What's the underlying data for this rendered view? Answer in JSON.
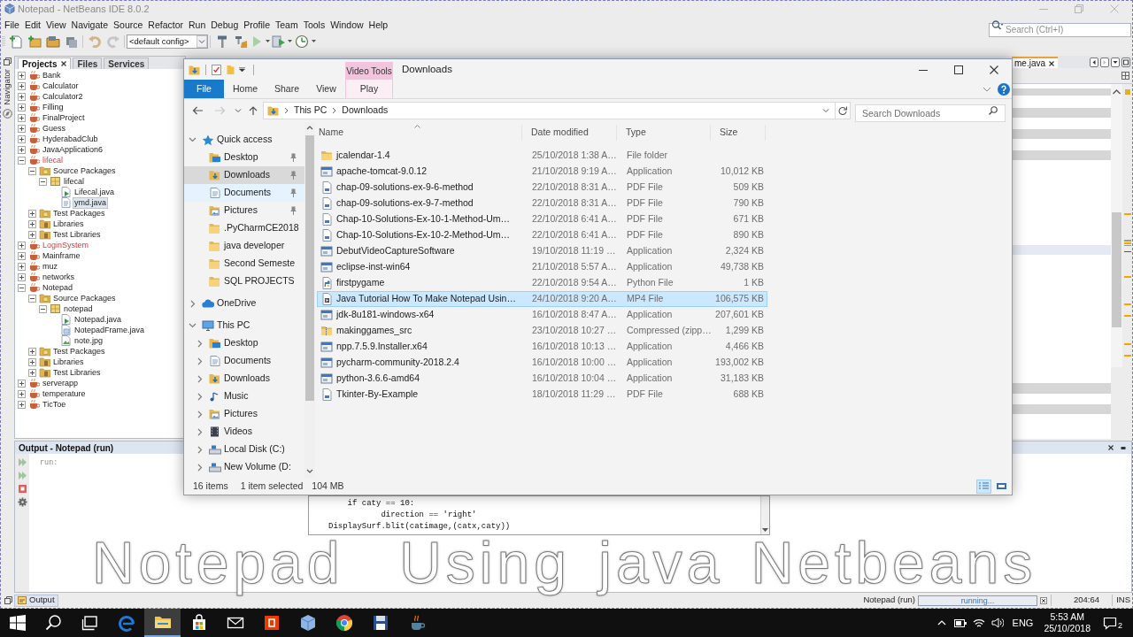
{
  "ide": {
    "title": "Notepad - NetBeans IDE 8.0.2",
    "menu": [
      "File",
      "Edit",
      "View",
      "Navigate",
      "Source",
      "Refactor",
      "Run",
      "Debug",
      "Profile",
      "Team",
      "Tools",
      "Window",
      "Help"
    ],
    "config": "<default config>",
    "search": {
      "placeholder": "Search (Ctrl+I)"
    },
    "side_label": "Navigator",
    "panel_tabs": [
      {
        "label": "Projects",
        "selected": true
      },
      {
        "label": "Files",
        "selected": false
      },
      {
        "label": "Services",
        "selected": false
      }
    ],
    "projects": [
      {
        "label": "Bank",
        "kind": "project",
        "expanded": false,
        "has_errors": false,
        "selected": false
      },
      {
        "label": "Calculator",
        "kind": "project",
        "expanded": false,
        "has_errors": false,
        "selected": false
      },
      {
        "label": "Calculator2",
        "kind": "project",
        "expanded": false,
        "has_errors": false,
        "selected": false
      },
      {
        "label": "Filling",
        "kind": "project",
        "expanded": false,
        "has_errors": false,
        "selected": false
      },
      {
        "label": "FinalProject",
        "kind": "project",
        "expanded": false,
        "has_errors": false,
        "selected": false
      },
      {
        "label": "Guess",
        "kind": "project",
        "expanded": false,
        "has_errors": false,
        "selected": false
      },
      {
        "label": "HyderabadClub",
        "kind": "project",
        "expanded": false,
        "has_errors": false,
        "selected": false
      },
      {
        "label": "JavaApplication6",
        "kind": "project",
        "expanded": false,
        "has_errors": false,
        "selected": false
      },
      {
        "label": "lifecal",
        "kind": "project",
        "expanded": true,
        "has_errors": true,
        "selected": false,
        "children": [
          {
            "label": "Source Packages",
            "kind": "source_folder",
            "expanded": true,
            "selected": false,
            "children": [
              {
                "label": "lifecal",
                "kind": "package",
                "expanded": true,
                "selected": false,
                "children": [
                  {
                    "label": "Lifecal.java",
                    "kind": "java_main",
                    "selected": false
                  },
                  {
                    "label": "ymd.java",
                    "kind": "java",
                    "selected": true
                  }
                ]
              }
            ]
          },
          {
            "label": "Test Packages",
            "kind": "source_folder",
            "expanded": false,
            "selected": false
          },
          {
            "label": "Libraries",
            "kind": "library",
            "expanded": false,
            "selected": false
          },
          {
            "label": "Test Libraries",
            "kind": "library",
            "expanded": false,
            "selected": false
          }
        ]
      },
      {
        "label": "LoginSystem",
        "kind": "project",
        "expanded": false,
        "has_errors": true,
        "selected": false
      },
      {
        "label": "Mainframe",
        "kind": "project",
        "expanded": false,
        "has_errors": false,
        "selected": false
      },
      {
        "label": "muz",
        "kind": "project",
        "expanded": false,
        "has_errors": false,
        "selected": false
      },
      {
        "label": "networks",
        "kind": "project",
        "expanded": false,
        "has_errors": false,
        "selected": false
      },
      {
        "label": "Notepad",
        "kind": "project",
        "expanded": true,
        "has_errors": false,
        "selected": false,
        "children": [
          {
            "label": "Source Packages",
            "kind": "source_folder",
            "expanded": true,
            "selected": false,
            "children": [
              {
                "label": "notepad",
                "kind": "package",
                "expanded": true,
                "selected": false,
                "children": [
                  {
                    "label": "Notepad.java",
                    "kind": "java_main",
                    "selected": false
                  },
                  {
                    "label": "NotepadFrame.java",
                    "kind": "java_form",
                    "selected": false
                  },
                  {
                    "label": "note.jpg",
                    "kind": "image",
                    "selected": false
                  }
                ]
              }
            ]
          },
          {
            "label": "Test Packages",
            "kind": "source_folder",
            "expanded": false,
            "selected": false
          },
          {
            "label": "Libraries",
            "kind": "library",
            "expanded": false,
            "selected": false
          },
          {
            "label": "Test Libraries",
            "kind": "library",
            "expanded": false,
            "selected": false
          }
        ]
      },
      {
        "label": "serverapp",
        "kind": "project",
        "expanded": false,
        "has_errors": false,
        "selected": false
      },
      {
        "label": "temperature",
        "kind": "project",
        "expanded": false,
        "has_errors": false,
        "selected": false
      },
      {
        "label": "TicToe",
        "kind": "project",
        "expanded": false,
        "has_errors": false,
        "selected": false
      }
    ],
    "editor_tab": "me.java",
    "output": {
      "title": "Output - Notepad (run)",
      "lines": [
        "run:"
      ]
    },
    "status_bar": {
      "output_tab": "Output",
      "task": "Notepad (run)",
      "progress_label": "running...",
      "position": "204:64",
      "mode": "INS"
    }
  },
  "explorer": {
    "context_tab": "Video Tools",
    "title": "Downloads",
    "ribbon_tabs": [
      {
        "label": "File",
        "kind": "file"
      },
      {
        "label": "Home",
        "kind": "standard"
      },
      {
        "label": "Share",
        "kind": "standard"
      },
      {
        "label": "View",
        "kind": "standard"
      },
      {
        "label": "Play",
        "kind": "contextual"
      }
    ],
    "address": [
      "This PC",
      "Downloads"
    ],
    "search": {
      "placeholder": "Search Downloads"
    },
    "navigation": [
      {
        "label": "Quick access",
        "kind": "star",
        "expanded": true,
        "selected": false,
        "children": [
          {
            "label": "Desktop",
            "kind": "desktop",
            "pinned": true,
            "selected": false,
            "hovered": false
          },
          {
            "label": "Downloads",
            "kind": "downloads",
            "pinned": true,
            "selected": true,
            "hovered": false
          },
          {
            "label": "Documents",
            "kind": "documents",
            "pinned": true,
            "selected": false,
            "hovered": true
          },
          {
            "label": "Pictures",
            "kind": "pictures",
            "pinned": true,
            "selected": false,
            "hovered": false
          },
          {
            "label": ".PyCharmCE2018",
            "kind": "folder",
            "pinned": false,
            "selected": false,
            "hovered": false
          },
          {
            "label": "java developer",
            "kind": "folder",
            "pinned": false,
            "selected": false,
            "hovered": false
          },
          {
            "label": "Second Semeste",
            "kind": "folder",
            "pinned": false,
            "selected": false,
            "hovered": false
          },
          {
            "label": "SQL PROJECTS",
            "kind": "folder",
            "pinned": false,
            "selected": false,
            "hovered": false
          }
        ]
      },
      {
        "label": "OneDrive",
        "kind": "cloud",
        "expanded": false,
        "selected": false
      },
      {
        "label": "This PC",
        "kind": "computer",
        "expanded": true,
        "selected": false,
        "children": [
          {
            "label": "Desktop",
            "kind": "desktop",
            "expanded": false,
            "selected": false
          },
          {
            "label": "Documents",
            "kind": "documents",
            "expanded": false,
            "selected": false
          },
          {
            "label": "Downloads",
            "kind": "downloads",
            "expanded": false,
            "selected": false
          },
          {
            "label": "Music",
            "kind": "music",
            "expanded": false,
            "selected": false
          },
          {
            "label": "Pictures",
            "kind": "pictures",
            "expanded": false,
            "selected": false
          },
          {
            "label": "Videos",
            "kind": "videos",
            "expanded": false,
            "selected": false
          },
          {
            "label": "Local Disk (C:)",
            "kind": "drive",
            "expanded": false,
            "selected": false
          },
          {
            "label": "New Volume (D:",
            "kind": "drive",
            "expanded": false,
            "selected": false
          }
        ]
      }
    ],
    "columns": [
      {
        "label": "Name",
        "sorted": true
      },
      {
        "label": "Date modified",
        "sorted": false
      },
      {
        "label": "Type",
        "sorted": false
      },
      {
        "label": "Size",
        "sorted": false
      }
    ],
    "files": [
      {
        "name": "jcalendar-1.4",
        "date": "25/10/2018 1:38 A…",
        "type": "File folder",
        "kind": "folder",
        "selected": false
      },
      {
        "name": "apache-tomcat-9.0.12",
        "date": "21/10/2018 9:19 A…",
        "type": "Application",
        "size": "10,012 KB",
        "kind": "application",
        "selected": false
      },
      {
        "name": "chap-09-solutions-ex-9-6-method",
        "date": "22/10/2018 8:31 A…",
        "type": "PDF File",
        "size": "509 KB",
        "kind": "pdf",
        "selected": false
      },
      {
        "name": "chap-09-solutions-ex-9-7-method",
        "date": "22/10/2018 8:31 A…",
        "type": "PDF File",
        "size": "790 KB",
        "kind": "pdf",
        "selected": false
      },
      {
        "name": "Chap-10-Solutions-Ex-10-1-Method-Um…",
        "date": "22/10/2018 6:41 A…",
        "type": "PDF File",
        "size": "671 KB",
        "kind": "pdf",
        "selected": false
      },
      {
        "name": "Chap-10-Solutions-Ex-10-2-Method-Um…",
        "date": "22/10/2018 6:41 A…",
        "type": "PDF File",
        "size": "890 KB",
        "kind": "pdf",
        "selected": false
      },
      {
        "name": "DebutVideoCaptureSoftware",
        "date": "19/10/2018 11:19 …",
        "type": "Application",
        "size": "2,324 KB",
        "kind": "application",
        "selected": false
      },
      {
        "name": "eclipse-inst-win64",
        "date": "21/10/2018 5:57 A…",
        "type": "Application",
        "size": "49,738 KB",
        "kind": "application",
        "selected": false
      },
      {
        "name": "firstpygame",
        "date": "22/10/2018 9:54 A…",
        "type": "Python File",
        "size": "1 KB",
        "kind": "python",
        "selected": false
      },
      {
        "name": "Java Tutorial How To Make Notepad Usin…",
        "date": "24/10/2018 9:20 A…",
        "type": "MP4 File",
        "size": "106,575 KB",
        "kind": "video",
        "selected": true
      },
      {
        "name": "jdk-8u181-windows-x64",
        "date": "16/10/2018 8:47 A…",
        "type": "Application",
        "size": "207,601 KB",
        "kind": "application",
        "selected": false
      },
      {
        "name": "makinggames_src",
        "date": "23/10/2018 10:27 …",
        "type": "Compressed (zipp…",
        "size": "1,299 KB",
        "kind": "archive",
        "selected": false
      },
      {
        "name": "npp.7.5.9.Installer.x64",
        "date": "16/10/2018 10:13 …",
        "type": "Application",
        "size": "4,466 KB",
        "kind": "application",
        "selected": false
      },
      {
        "name": "pycharm-community-2018.2.4",
        "date": "16/10/2018 10:00 …",
        "type": "Application",
        "size": "193,002 KB",
        "kind": "application",
        "selected": false
      },
      {
        "name": "python-3.6.6-amd64",
        "date": "16/10/2018 10:04 …",
        "type": "Application",
        "size": "31,183 KB",
        "kind": "application",
        "selected": false
      },
      {
        "name": "Tkinter-By-Example",
        "date": "18/10/2018 11:29 …",
        "type": "PDF File",
        "size": "688 KB",
        "kind": "pdf",
        "selected": false
      }
    ],
    "status": {
      "items": "16 items",
      "selection": "1 item selected",
      "size": "104 MB"
    },
    "view_buttons": [
      {
        "kind": "details",
        "selected": true
      },
      {
        "kind": "large_icons",
        "selected": false
      }
    ]
  },
  "code_window": {
    "lines": [
      "    if caty == 10:",
      "           direction == 'right'",
      "DisplaySurf.blit(catimage,(catx,caty))"
    ]
  },
  "caption": "Notepad  Using java Netbeans",
  "taskbar": {
    "apps": [
      {
        "kind": "start",
        "active": false
      },
      {
        "kind": "search",
        "active": false
      },
      {
        "kind": "task_view",
        "active": false
      },
      {
        "kind": "edge",
        "active": false
      },
      {
        "kind": "file_explorer",
        "active": true
      },
      {
        "kind": "store",
        "active": false
      },
      {
        "kind": "mail",
        "active": false
      },
      {
        "kind": "office",
        "active": false
      },
      {
        "kind": "cube",
        "active": false
      },
      {
        "kind": "chrome",
        "active": false
      },
      {
        "kind": "floppy",
        "active": false
      },
      {
        "kind": "java",
        "active": false
      }
    ],
    "language": "ENG",
    "time": "5:53 AM",
    "date": "25/10/2018",
    "notifications": "2"
  }
}
